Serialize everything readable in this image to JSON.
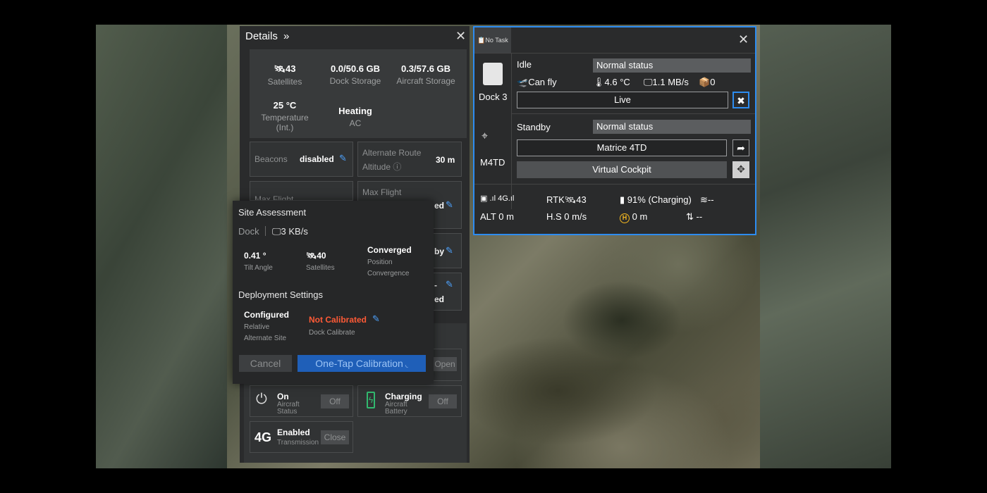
{
  "details": {
    "title": "Details",
    "title_icon": "chevrons-right-icon",
    "stats": [
      {
        "value": "43",
        "label": "Satellites",
        "icon": "satellite-icon"
      },
      {
        "value": "0.0/50.6 GB",
        "label": "Dock Storage"
      },
      {
        "value": "0.3/57.6 GB",
        "label": "Aircraft Storage"
      },
      {
        "value": "25 °C",
        "label": "Temperature (Int.)"
      },
      {
        "value": "Heating",
        "label": "AC"
      }
    ],
    "beacons": {
      "label": "Beacons",
      "value": "disabled"
    },
    "alt_route": {
      "label1": "Alternate Route",
      "label2": "Altitude",
      "value": "30 m"
    },
    "max_flight_left": "Max Flight",
    "max_flight_right": "Max Flight",
    "partial_values": [
      "ed",
      "by",
      "-",
      "ed"
    ],
    "open_button": "Open",
    "aircraft_status": {
      "value": "On",
      "label1": "Aircraft",
      "label2": "Status",
      "button": "Off"
    },
    "aircraft_battery": {
      "value": "Charging",
      "label1": "Aircraft",
      "label2": "Battery",
      "button": "Off"
    },
    "transmission": {
      "icon_text": "4G",
      "value": "Enabled",
      "label": "Transmission",
      "button": "Close"
    }
  },
  "site_assessment": {
    "title": "Site Assessment",
    "dock_label": "Dock",
    "rate": "3 KB/s",
    "tilt": {
      "value": "0.41 °",
      "label": "Tilt Angle"
    },
    "satellites": {
      "value": "40",
      "label": "Satellites"
    },
    "position": {
      "value": "Converged",
      "label1": "Position",
      "label2": "Convergence"
    },
    "deployment_title": "Deployment Settings",
    "configured": {
      "value": "Configured",
      "label1": "Relative",
      "label2": "Alternate Site"
    },
    "calibration": {
      "value": "Not Calibrated",
      "label": "Dock Calibrate",
      "color": "#ff5a36"
    },
    "cancel": "Cancel",
    "one_tap": "One-Tap Calibration"
  },
  "dock_panel": {
    "tag": "No Task",
    "dock": {
      "name": "Dock 3",
      "state": "Idle",
      "status": "Normal status",
      "can_fly": "Can fly",
      "temp": "4.6 °C",
      "rate": "1.1 MB/s",
      "count": "0",
      "live_button": "Live"
    },
    "aircraft": {
      "name": "M4TD",
      "state": "Standby",
      "status": "Normal status",
      "model_button": "Matrice 4TD",
      "cockpit_button": "Virtual Cockpit"
    },
    "telemetry": {
      "signal": "4G",
      "rtk": "RTK",
      "rtk_sats": "43",
      "battery": "91%",
      "charging": "(Charging)",
      "wind": "--",
      "alt": "ALT 0 m",
      "hs": "H.S 0 m/s",
      "home_dist": "0 m",
      "vs": "--"
    }
  },
  "colors": {
    "accent": "#2d8cf0",
    "status_green": "#32b96f",
    "warning": "#ff5a36"
  }
}
